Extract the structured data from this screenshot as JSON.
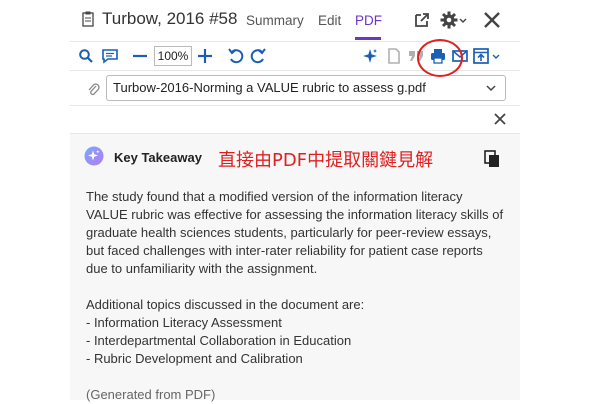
{
  "header": {
    "title": "Turbow, 2016 #58",
    "tabs": [
      {
        "label": "Summary"
      },
      {
        "label": "Edit"
      },
      {
        "label": "PDF"
      }
    ],
    "active_tab": "PDF"
  },
  "toolbar": {
    "zoom": "100%"
  },
  "file": {
    "name": "Turbow-2016-Norming a VALUE rubric to assess g.pdf"
  },
  "card": {
    "title": "Key Takeaway",
    "overlay_note": "直接由PDF中提取關鍵見解",
    "paragraph_lines": [
      "The study found that a modified version of the information literacy",
      "VALUE rubric was effective for assessing the information literacy skills of",
      "graduate health sciences students, particularly for peer-review essays,",
      "but faced challenges with inter-rater reliability for patient case reports",
      "due to unfamiliarity with the assignment."
    ],
    "topics_intro": "Additional topics discussed in the document are:",
    "topics": [
      "- Information Literacy Assessment",
      "- Interdepartmental Collaboration in Education",
      "- Rubric Development and Calibration"
    ],
    "footer": "(Generated from PDF)"
  },
  "colors": {
    "accent": "#6d36c7",
    "annotation": "#e02020",
    "action_blue": "#1a5fb4"
  },
  "icons": [
    "document-icon",
    "open-external-icon",
    "gear-icon",
    "close-icon",
    "search-icon",
    "comment-icon",
    "zoom-out-icon",
    "zoom-in-icon",
    "rotate-left-icon",
    "rotate-right-icon",
    "ai-sparkle-icon",
    "page-icon",
    "quote-icon",
    "print-icon",
    "email-icon",
    "export-icon",
    "paperclip-icon",
    "copy-icon"
  ]
}
